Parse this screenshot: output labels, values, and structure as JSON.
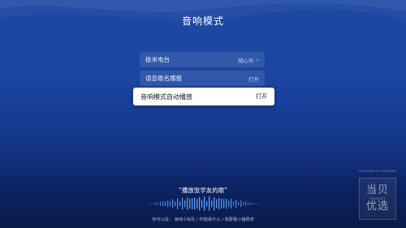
{
  "page": {
    "title": "音响模式"
  },
  "menu": {
    "items": [
      {
        "label": "极米电台",
        "value": "随心听",
        "has_chevron": true
      },
      {
        "label": "语音歌名播报",
        "value": "打开",
        "has_chevron": false
      },
      {
        "label": "音响模式自动播放",
        "value": "打开",
        "has_chevron": false,
        "focused": true
      }
    ]
  },
  "voice": {
    "prompt": "“播放张学友的歌”",
    "hint": "你可以说：  海绵小纵队 / 你能做什么 / 我要看小猪佩奇"
  },
  "brand": {
    "powered_by": "POWERED BY DANGBEI",
    "line1": "当贝",
    "mid": "DANGBEI",
    "line2": "优选"
  },
  "colors": {
    "bg_top": "#1d48a3",
    "bg_bottom": "#0a1a4a",
    "wave": "#5aa6ff",
    "focused_bg": "#ffffff"
  },
  "icons": {
    "chevron": "chevron-right-icon"
  }
}
